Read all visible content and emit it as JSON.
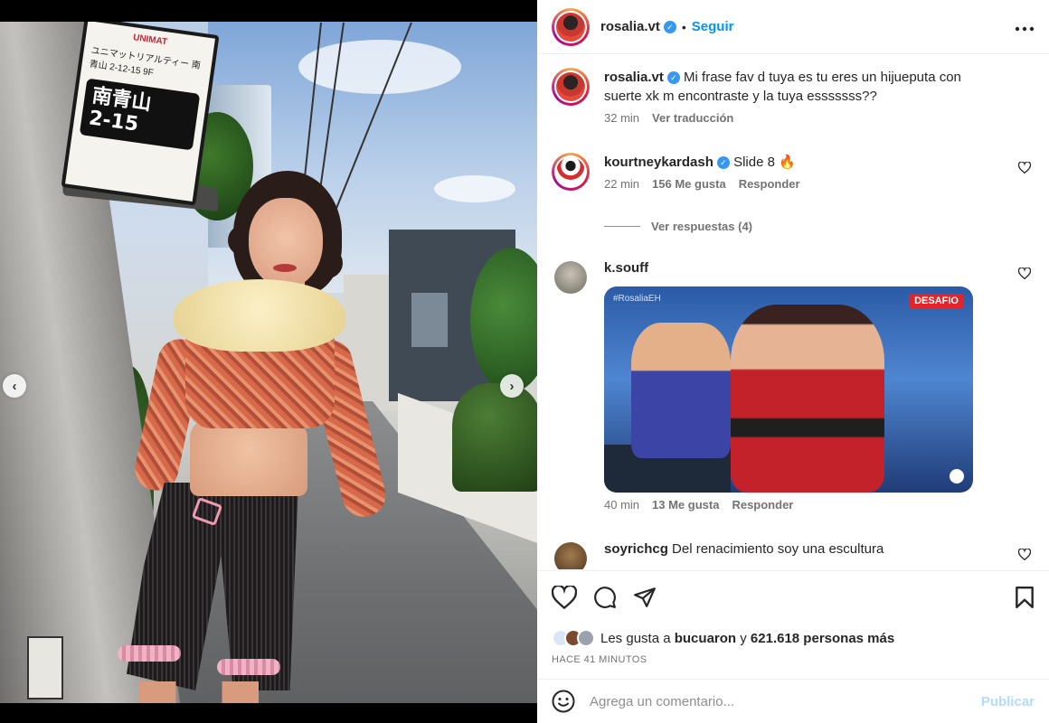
{
  "post": {
    "author": "rosalia.vt",
    "follow_label": "Seguir",
    "more_icon": "more-horizontal-icon",
    "verified_mark": "✓"
  },
  "media": {
    "sign_top": "UNIMAT",
    "sign_line": "ユニマットリアルティー 南青山 2-12-15 9F",
    "sign_box": "南青山\n2-15",
    "carousel_total": 8,
    "carousel_index": 7,
    "prev_icon": "‹",
    "next_icon": "›"
  },
  "comments": [
    {
      "user": "rosalia.vt",
      "verified": true,
      "text": "Mi frase fav d tuya es tu eres un hijueputa con suerte xk m encontraste y la tuya esssssss??",
      "time": "32 min",
      "action": "Ver traducción"
    },
    {
      "user": "kourtneykardash",
      "verified": true,
      "text": "Slide 8 🔥",
      "time": "22 min",
      "likes": "156 Me gusta",
      "action": "Responder",
      "replies_label": "Ver respuestas (4)"
    },
    {
      "user": "k.souff",
      "verified": false,
      "text": "",
      "time": "40 min",
      "likes": "13 Me gusta",
      "action": "Responder",
      "gif_tag": "#RosaliaEH",
      "gif_badge": "DESAFIO"
    },
    {
      "user": "soyrichcg",
      "verified": false,
      "text": "Del renacimiento soy una escultura"
    }
  ],
  "likes": {
    "prefix": "Les gusta a",
    "user": "bucuaron",
    "connector": "y",
    "others": "621.618 personas más"
  },
  "timestamp": "HACE 41 MINUTOS",
  "add_comment": {
    "placeholder": "Agrega un comentario...",
    "post_label": "Publicar"
  },
  "colors": {
    "accent": "#0095f6",
    "verified": "#3897f0",
    "muted": "#737373"
  }
}
